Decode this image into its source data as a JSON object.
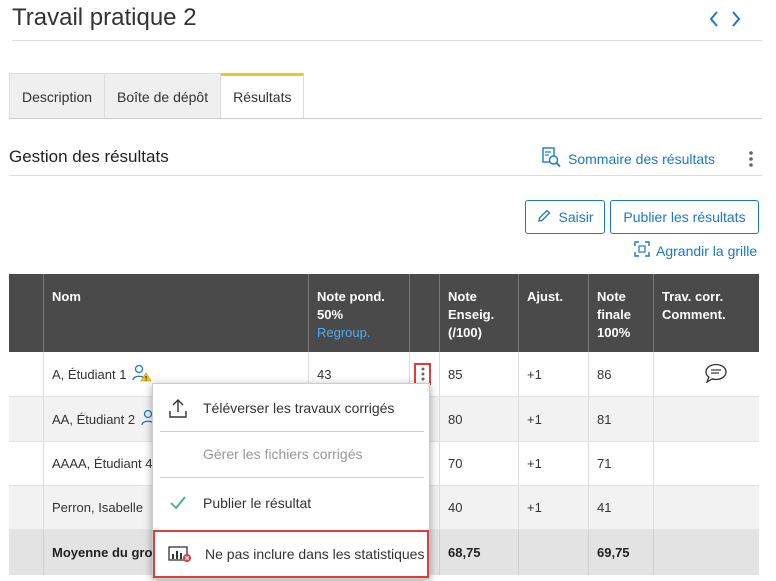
{
  "page": {
    "title": "Travail pratique 2"
  },
  "tabs": [
    {
      "label": "Description"
    },
    {
      "label": "Boîte de dépôt"
    },
    {
      "label": "Résultats"
    }
  ],
  "section": {
    "title": "Gestion des résultats",
    "summary_link": "Sommaire des résultats"
  },
  "actions": {
    "saisir": "Saisir",
    "publier": "Publier les résultats",
    "enlarge": "Agrandir la grille"
  },
  "table": {
    "headers": {
      "nom": "Nom",
      "note_pond_1": "Note pond.",
      "note_pond_2": "50%",
      "note_pond_link": "Regroup.",
      "enseig_1": "Note",
      "enseig_2": "Enseig.",
      "enseig_3": "(/100)",
      "ajust": "Ajust.",
      "finale_1": "Note",
      "finale_2": "finale",
      "finale_3": "100%",
      "trav_1": "Trav. corr.",
      "trav_2": "Comment."
    },
    "rows": [
      {
        "name": "A, Étudiant 1",
        "note_pond": "43",
        "enseig": "85",
        "ajust": "+1",
        "finale": "86"
      },
      {
        "name": "AA, Étudiant 2",
        "note_pond": "",
        "enseig": "80",
        "ajust": "+1",
        "finale": "81"
      },
      {
        "name": "AAAA, Étudiant 4",
        "note_pond": "",
        "enseig": "70",
        "ajust": "+1",
        "finale": "71"
      },
      {
        "name": "Perron, Isabelle",
        "note_pond": "",
        "enseig": "40",
        "ajust": "+1",
        "finale": "41"
      }
    ],
    "average": {
      "label": "Moyenne du gro",
      "enseig": "68,75",
      "finale": "69,75"
    }
  },
  "context_menu": {
    "upload": "Téléverser les travaux corrigés",
    "manage": "Gérer les fichiers corrigés",
    "publish": "Publier le résultat",
    "exclude": "Ne pas inclure dans les statistiques"
  },
  "colors": {
    "accent": "#1b79c4",
    "tab_active": "#f2c230",
    "highlight": "#e03c3c",
    "header_bg": "#4a4a4a",
    "check": "#3cb371"
  }
}
